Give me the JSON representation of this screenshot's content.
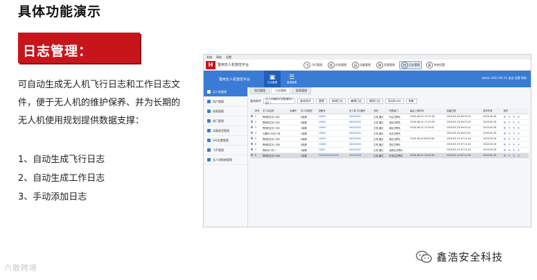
{
  "slide": {
    "title": "具体功能演示",
    "section_title": "日志管理：",
    "description": "可自动生成无人机飞行日志和工作日志文件，便于无人机的维护保养、并为长期的无人机使用规划提供数据支撑：",
    "bullets": [
      "1、自动生成飞行日志",
      "2、自动生成工作日志",
      "3、手动添加日志"
    ],
    "watermark_left": "六散跨境",
    "watermark_right": "鑫浩安全科技"
  },
  "app": {
    "menu": [
      "系统",
      "帮助",
      "设置"
    ],
    "logo_text": "H",
    "name": "警用无人机管控平台",
    "platform": "警用无人机管控平台",
    "modules": [
      {
        "icon": "飞",
        "label": "飞行管理",
        "active": false
      },
      {
        "icon": "任",
        "label": "任务管理",
        "active": false
      },
      {
        "icon": "设",
        "label": "设备管理",
        "active": false
      },
      {
        "icon": "资",
        "label": "资源管理",
        "active": false
      },
      {
        "icon": "日",
        "label": "日志管理",
        "active": true
      },
      {
        "icon": "系",
        "label": "系统设置",
        "active": false
      }
    ],
    "nav_buttons": [
      {
        "icon": "▣",
        "label": "日志管理",
        "active": true
      },
      {
        "icon": "☰",
        "label": "报表管理",
        "active": false
      }
    ],
    "user_info": "admin  2017-05-11  退出  设置  帮助",
    "sidebar": [
      {
        "label": "无人机管理",
        "active": true
      },
      {
        "label": "用户管理",
        "active": false
      },
      {
        "label": "权限管理",
        "active": false
      },
      {
        "label": "部门管理",
        "active": false
      },
      {
        "label": "设备类型管理",
        "active": false
      },
      {
        "label": "GIS设置管理",
        "active": false
      },
      {
        "label": "飞手管理",
        "active": false
      },
      {
        "label": "无人机报废管理",
        "active": false
      }
    ],
    "tabs": [
      {
        "label": "首页管理",
        "active": false
      },
      {
        "label": "日志管理",
        "active": true
      },
      {
        "label": "报表管理",
        "active": false
      }
    ],
    "toolbar": {
      "query_label": "查询条件",
      "filter_placeholder": "无人机编码/设备编码/部门",
      "buttons": [
        "查询条件",
        "重置",
        "新增日志",
        "编辑日志",
        "删除日志",
        "导出Excel",
        "刷新"
      ]
    },
    "table": {
      "columns": [
        "",
        "序号",
        "无人机名称",
        "ID编号",
        "无人机类型",
        "设备号",
        "无人机飞行编号",
        "状态",
        "所属部门",
        "最近上报时间",
        "创建日期",
        "操作时间",
        "操作"
      ],
      "rows": [
        {
          "selected": false,
          "cells": [
            "1",
            "警用航空无人机1",
            "",
            "8旋翼",
            "10001",
            "00010001",
            "正常,通过",
            "东区交警队",
            "2018-06-24 17:25:38",
            "2018-05-28 09:51:01",
            "2018-05-28"
          ]
        },
        {
          "selected": false,
          "cells": [
            "2",
            "警用航空无人机2",
            "",
            "6旋翼",
            "10002",
            "00010002",
            "正常,通过",
            "西区交警队",
            "2018-06-24 17:25:38",
            "2018-05-28 09:51:01",
            "2018-05-28"
          ]
        },
        {
          "selected": false,
          "cells": [
            "3",
            "警用航空无人机3",
            "",
            "4旋翼",
            "10003",
            "00010003",
            "正常,通过",
            "南区交警队",
            "2018-06-24 17:26:07",
            "2018-05-28 09:51:01",
            "2018-05-28"
          ]
        },
        {
          "selected": false,
          "cells": [
            "4",
            "大疆M100无人机",
            "",
            "4旋翼",
            "10004",
            "00010004",
            "正常,通过",
            "北区交警队",
            "",
            "2018-05-28 09:51:01",
            "2018-05-28"
          ]
        },
        {
          "selected": false,
          "cells": [
            "5",
            "警用航空无人机5",
            "",
            "6旋翼",
            "10005",
            "00010005",
            "正常,通过",
            "城区交警队",
            "2018-06-20 09:00:00",
            "2018-05-29 07:11:44",
            "2018-05-28"
          ]
        },
        {
          "selected": false,
          "cells": [
            "6",
            "警用航空无人机6",
            "",
            "8旋翼",
            "10006",
            "00010006",
            "正常,通过",
            "郊区交警队",
            "",
            "2018-05-29 07:11:44",
            "2018-05-28"
          ]
        },
        {
          "selected": false,
          "cells": [
            "7",
            "警用无人机 7",
            "",
            "4旋翼",
            "10007",
            "00010007",
            "正常,通过",
            "高新区交警队",
            "",
            "2018-05-29 07:11:44",
            "2018-05-28"
          ]
        },
        {
          "selected": true,
          "cells": [
            "8",
            "警用航空无人机8",
            "",
            "4旋翼",
            "20000000000043",
            "00010008",
            "正常,通过",
            "开发区交警队",
            "2018-06-25 10:00:00",
            "2018-05-29 07:11:44",
            "2018-05-28"
          ]
        }
      ],
      "actions": "⚙ ✎ ✎ ✕"
    }
  }
}
